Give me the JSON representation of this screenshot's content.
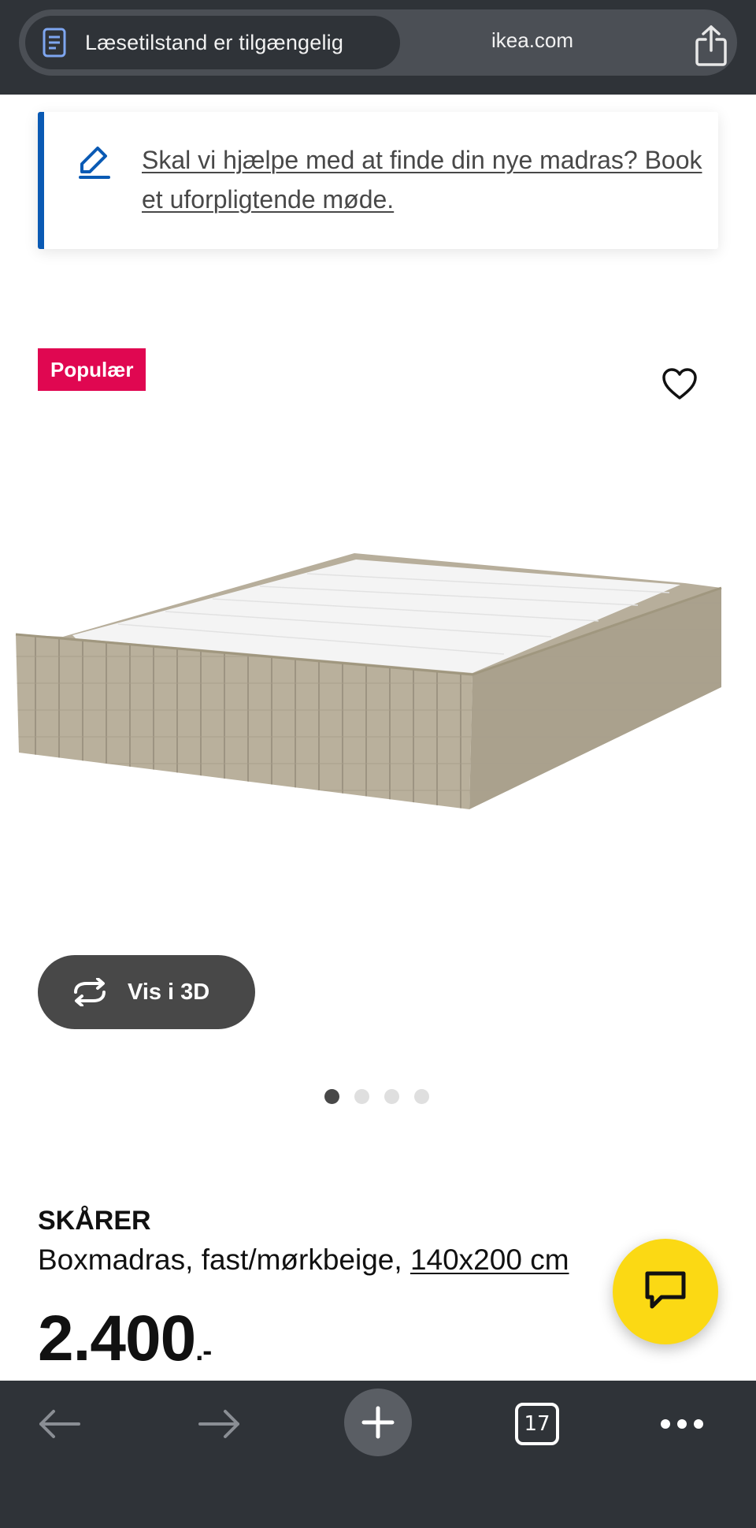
{
  "browser": {
    "reader_label": "Læsetilstand er tilgængelig",
    "domain": "ikea.com",
    "tab_count": "17"
  },
  "help_banner": {
    "link_text": "Skal vi hjælpe med at finde din nye madras? Book et uforpligtende møde."
  },
  "product": {
    "badge": "Populær",
    "view3d_label": "Vis i 3D",
    "gallery": {
      "count": 4,
      "active_index": 0
    },
    "name": "SKÅRER",
    "description": "Boxmadras, fast/mørkbeige, ",
    "size": "140x200 cm",
    "price_main": "2.400",
    "price_suffix": ".-"
  },
  "icons": {
    "reader": "reader-mode-icon",
    "share": "share-icon",
    "pen": "pen-icon",
    "favorite": "heart-icon",
    "rotate": "rotate-3d-icon",
    "chat": "chat-icon",
    "back": "arrow-left-icon",
    "forward": "arrow-right-icon",
    "new_tab": "plus-icon",
    "more": "more-dots-icon"
  },
  "colors": {
    "browser_bar": "#2f3338",
    "accent_blue": "#0a5ab4",
    "badge_red": "#e00751",
    "chat_yellow": "#fbd914"
  }
}
